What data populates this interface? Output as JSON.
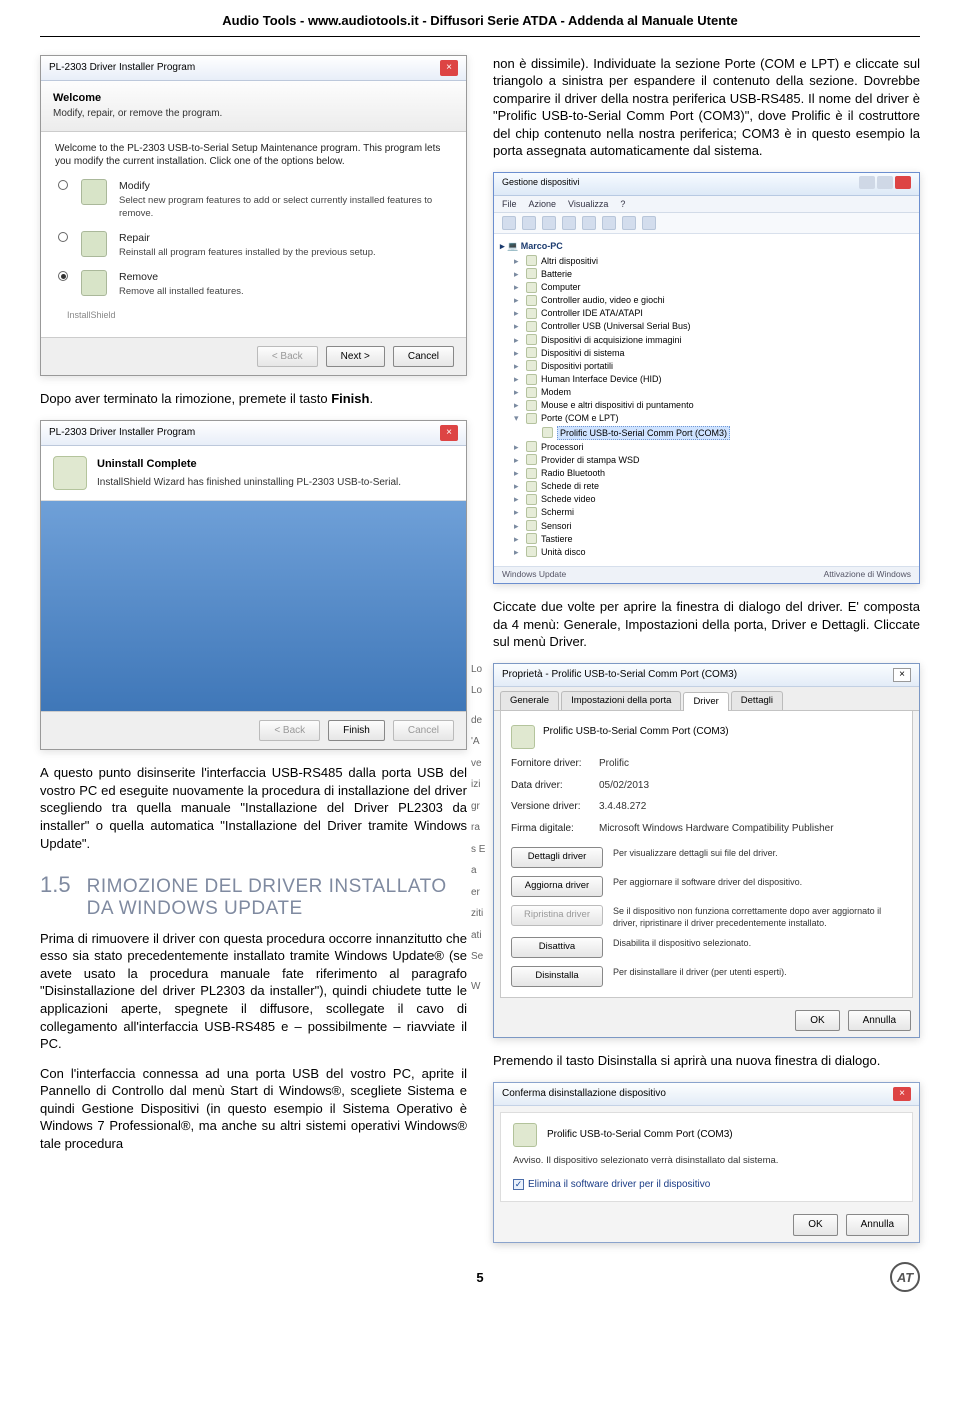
{
  "header": "Audio Tools - www.audiotools.it - Diffusori Serie ATDA - Addenda al Manuale Utente",
  "page_number": "5",
  "installer1": {
    "title": "PL-2303 Driver Installer Program",
    "welcome_title": "Welcome",
    "welcome_sub": "Modify, repair, or remove the program.",
    "intro": "Welcome to the PL-2303 USB-to-Serial Setup Maintenance program. This program lets you modify the current installation. Click one of the options below.",
    "modify_label": "Modify",
    "modify_desc": "Select new program features to add or select currently installed features to remove.",
    "repair_label": "Repair",
    "repair_desc": "Reinstall all program features installed by the previous setup.",
    "remove_label": "Remove",
    "remove_desc": "Remove all installed features.",
    "installshield": "InstallShield",
    "back_btn": "< Back",
    "next_btn": "Next >",
    "cancel_btn": "Cancel"
  },
  "after_remove_text": "Dopo aver terminato la rimozione, premete il tasto ",
  "after_remove_bold": "Finish",
  "installer2": {
    "title": "PL-2303 Driver Installer Program",
    "heading": "Uninstall Complete",
    "desc": "InstallShield Wizard has finished uninstalling PL-2303 USB-to-Serial.",
    "back_btn": "< Back",
    "finish_btn": "Finish",
    "cancel_btn": "Cancel"
  },
  "para_after_uninstall": "A questo punto disinserite l'interfaccia USB-RS485 dalla porta USB del vostro PC ed eseguite nuovamente la procedura di installazione del driver scegliendo tra quella manuale \"Installazione del Driver PL2303 da installer\" o quella automatica \"Installazione del Driver tramite Windows Update\".",
  "section": {
    "num": "1.5",
    "title_line1": "RIMOZIONE DEL DRIVER INSTALLATO",
    "title_line2": "DA WINDOWS UPDATE"
  },
  "para15a": "Prima di rimuovere il driver con questa procedura occorre innanzitutto che esso sia stato precedentemente installato tramite Windows Update® (se avete usato la procedura manuale fate riferimento al paragrafo \"Disinstallazione del driver PL2303 da installer\"), quindi chiudete tutte le applicazioni aperte, spegnete il diffusore, scollegate il cavo di collegamento all'interfaccia USB-RS485 e – possibilmente – riavviate il PC.",
  "para15b": "Con l'interfaccia connessa ad una porta USB del vostro PC, aprite il Pannello di Controllo dal menù Start di Windows®, scegliete Sistema e quindi Gestione Dispositivi (in questo esempio il Sistema Operativo è Windows 7 Professional®, ma anche su altri sistemi operativi Windows® tale procedura",
  "right_para1": "non è dissimile). Individuate la sezione Porte (COM e LPT) e cliccate sul triangolo a sinistra per espandere il contenuto della sezione. Dovrebbe comparire il driver della nostra periferica USB-RS485. Il nome del driver è \"Prolific USB-to-Serial Comm Port (COM3)\", dove Prolific è il costruttore del chip contenuto nella nostra periferica; COM3 è in questo esempio la porta assegnata automaticamente dal sistema.",
  "devmgr": {
    "title": "Gestione dispositivi",
    "menu": [
      "File",
      "Azione",
      "Visualizza",
      "?"
    ],
    "root": "Marco-PC",
    "items": [
      "Altri dispositivi",
      "Batterie",
      "Computer",
      "Controller audio, video e giochi",
      "Controller IDE ATA/ATAPI",
      "Controller USB (Universal Serial Bus)",
      "Dispositivi di acquisizione immagini",
      "Dispositivi di sistema",
      "Dispositivi portatili",
      "Human Interface Device (HID)",
      "Modem",
      "Mouse e altri dispositivi di puntamento"
    ],
    "ports_label": "Porte (COM e LPT)",
    "ports_child": "Prolific USB-to-Serial Comm Port (COM3)",
    "items_after": [
      "Processori",
      "Provider di stampa WSD",
      "Radio Bluetooth",
      "Schede di rete",
      "Schede video",
      "Schermi",
      "Sensori",
      "Tastiere",
      "Unità disco"
    ],
    "footer_left": "Windows Update",
    "footer_right": "Attivazione di Windows"
  },
  "right_para2": "Ciccate due volte per aprire la finestra di dialogo del driver. E' composta da 4 menù: Generale, Impostazioni della porta, Driver e Dettagli. Cliccate sul menù Driver.",
  "propdlg": {
    "title": "Proprietà - Prolific USB-to-Serial Comm Port (COM3)",
    "tabs": [
      "Generale",
      "Impostazioni della porta",
      "Driver",
      "Dettagli"
    ],
    "name": "Prolific USB-to-Serial Comm Port (COM3)",
    "rows": {
      "fornitore_l": "Fornitore driver:",
      "fornitore_v": "Prolific",
      "data_l": "Data driver:",
      "data_v": "05/02/2013",
      "versione_l": "Versione driver:",
      "versione_v": "3.4.48.272",
      "firma_l": "Firma digitale:",
      "firma_v": "Microsoft Windows Hardware Compatibility Publisher"
    },
    "buttons": {
      "dettagli": "Dettagli driver",
      "dettagli_desc": "Per visualizzare dettagli sui file del driver.",
      "aggiorna": "Aggiorna driver",
      "aggiorna_desc": "Per aggiornare il software driver del dispositivo.",
      "ripristina": "Ripristina driver",
      "ripristina_desc": "Se il dispositivo non funziona correttamente dopo aver aggiornato il driver, ripristinare il driver precedentemente installato.",
      "disattiva": "Disattiva",
      "disattiva_desc": "Disabilita il dispositivo selezionato.",
      "disinstalla": "Disinstalla",
      "disinstalla_desc": "Per disinstallare il driver (per utenti esperti)."
    },
    "ok": "OK",
    "annulla": "Annulla"
  },
  "right_para3": "Premendo il tasto Disinstalla si aprirà una nuova finestra di dialogo.",
  "confirm": {
    "title": "Conferma disinstallazione dispositivo",
    "name": "Prolific USB-to-Serial Comm Port (COM3)",
    "msg": "Avviso. Il dispositivo selezionato verrà disinstallato dal sistema.",
    "chk": "Elimina il software driver per il dispositivo",
    "ok": "OK",
    "annulla": "Annulla"
  },
  "edge_letters": [
    "Lo",
    "Lo",
    "",
    "de",
    "'A",
    "ve",
    "izi",
    "gr",
    "ra",
    "s E",
    "a",
    "er",
    "ziti",
    "ati",
    "Se",
    "",
    "W"
  ]
}
